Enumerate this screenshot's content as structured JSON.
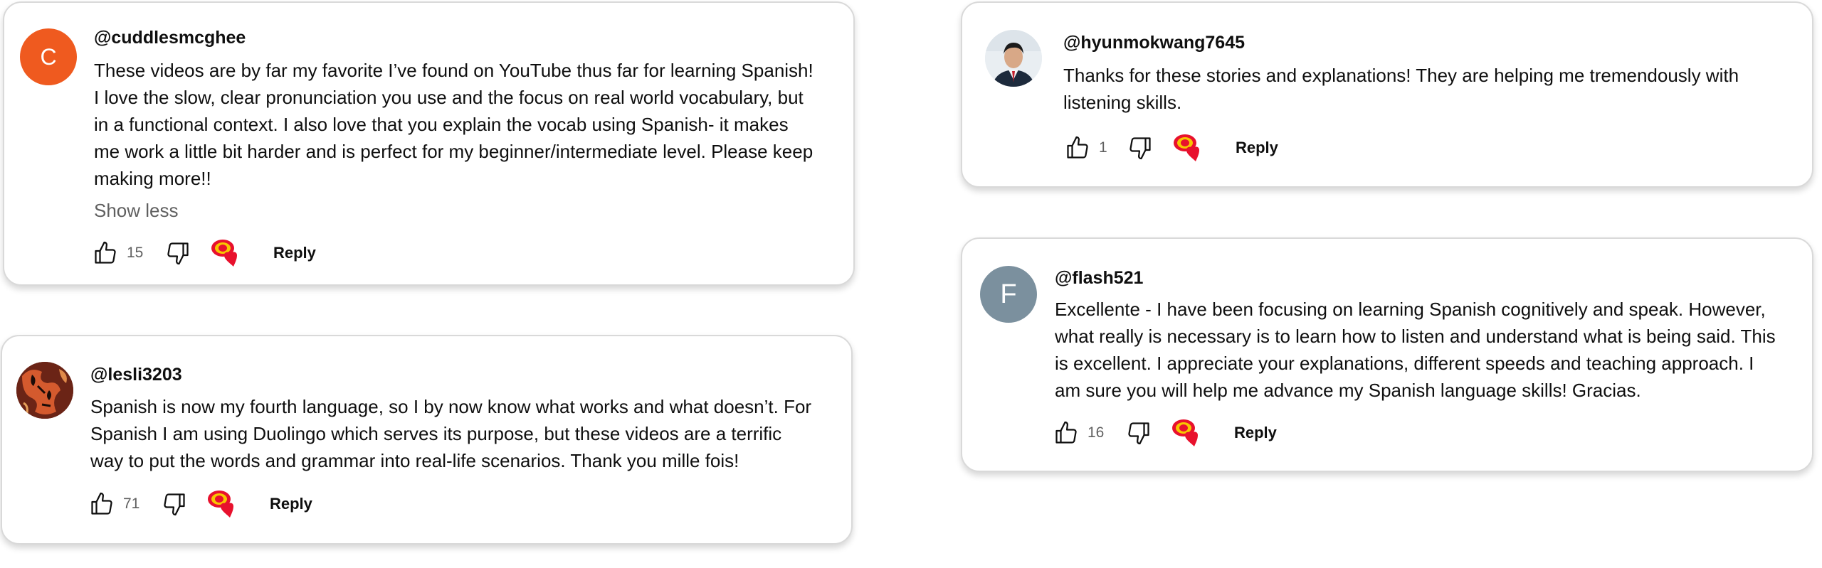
{
  "comments": [
    {
      "handle": "@cuddlesmcghee",
      "avatar_letter": "C",
      "avatar_color": "#ef5a1f",
      "lines": [
        "These videos are by far my favorite I’ve found on YouTube thus far for learning Spanish!",
        "I love the slow, clear pronunciation you use and the focus on real world vocabulary, but",
        "in a functional context. I also love that you explain the vocab using Spanish- it makes",
        "me work a little bit harder and is perfect for my beginner/intermediate level. Please keep",
        "making more!!"
      ],
      "show_less": "Show less",
      "likes": "15",
      "reply_label": "Reply"
    },
    {
      "handle": "@lesli3203",
      "avatar_icon": "abstract-art-avatar",
      "lines": [
        "Spanish is now my fourth language, so I by now know what works and what doesn’t. For",
        "Spanish I am using Duolingo which serves its purpose, but these videos are a terrific",
        "way to put the words and grammar into real-life scenarios. Thank you mille fois!"
      ],
      "likes": "71",
      "reply_label": "Reply"
    },
    {
      "handle": "@hyunmokwang7645",
      "avatar_icon": "person-photo-avatar",
      "lines": [
        "Thanks for these stories and explanations! They are helping me tremendously with",
        "listening skills."
      ],
      "likes": "1",
      "reply_label": "Reply"
    },
    {
      "handle": "@flash521",
      "avatar_letter": "F",
      "avatar_color": "#7b909e",
      "lines": [
        "Excellente - I have been focusing on learning Spanish cognitively and speak. However,",
        "what really is necessary is to learn how to listen and understand what is being said. This",
        "is excellent. I appreciate your explanations, different speeds and teaching approach. I",
        "am sure you will help me advance my Spanish language skills! Gracias."
      ],
      "likes": "16",
      "reply_label": "Reply"
    }
  ],
  "icons": {
    "like": "thumbs-up-icon",
    "dislike": "thumbs-down-icon",
    "creator_heart": "creator-heart-icon"
  },
  "colors": {
    "heart": "#e8112d",
    "badge": "#f7c600",
    "meta_text": "#606060"
  }
}
